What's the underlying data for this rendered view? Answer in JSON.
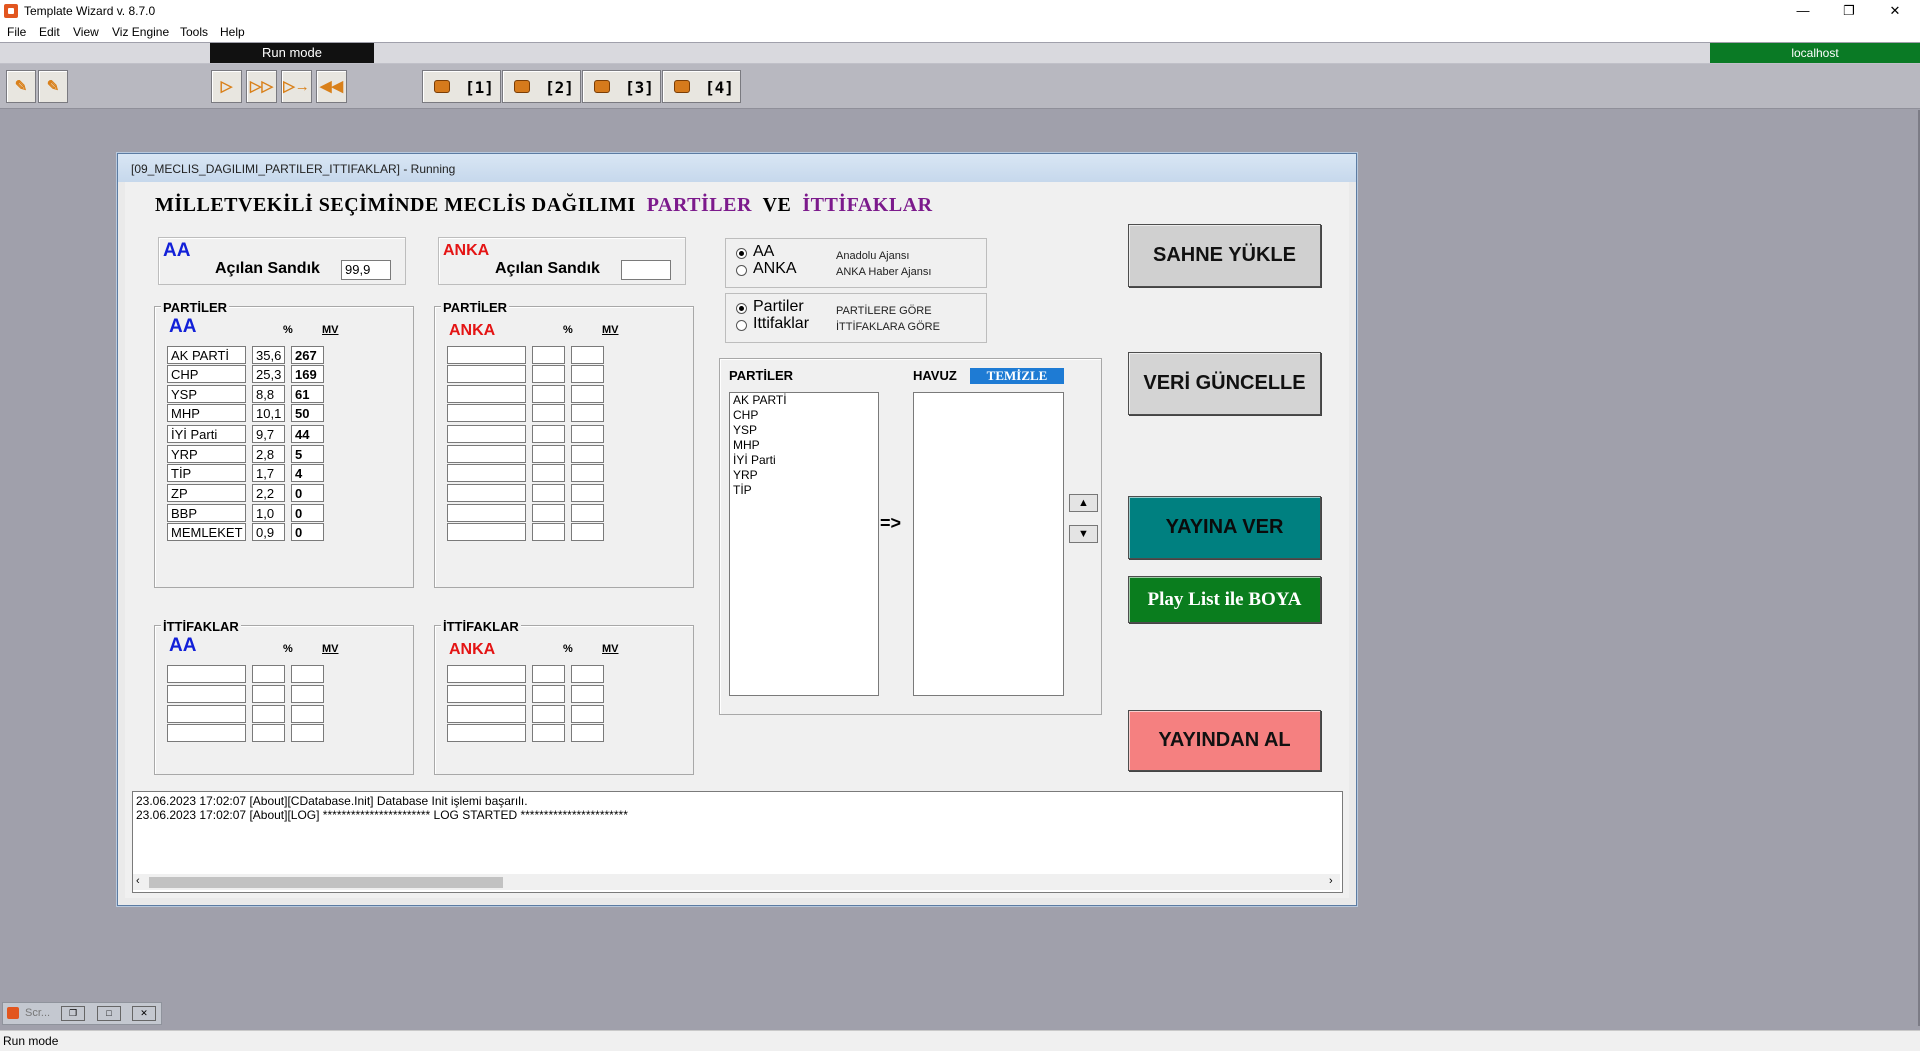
{
  "app": {
    "title": "Template Wizard v. 8.7.0"
  },
  "menu": [
    "File",
    "Edit",
    "View",
    "Viz Engine",
    "Tools",
    "Help"
  ],
  "statusstrip": {
    "mode": "Run mode",
    "host": "localhost"
  },
  "toolbar": {
    "cameras": [
      "[1]",
      "[2]",
      "[3]",
      "[4]"
    ]
  },
  "window": {
    "caption": "[09_MECLIS_DAGILIMI_PARTILER_ITTIFAKLAR] - Running",
    "heading_main": "MİLLETVEKİLİ SEÇİMİNDE MECLİS DAĞILIMI",
    "heading_p1": "PARTİLER",
    "heading_ve": "VE",
    "heading_p2": "İTTİFAKLAR"
  },
  "aa": {
    "label": "AA",
    "acilan_label": "Açılan Sandık",
    "acilan_value": "99,9",
    "partiler_title": "PARTİLER",
    "ittifak_title": "İTTİFAKLAR",
    "pct_head": "%",
    "mv_head": "MV",
    "rows": [
      {
        "name": "AK PARTİ",
        "pct": "35,6",
        "mv": "267"
      },
      {
        "name": "CHP",
        "pct": "25,3",
        "mv": "169"
      },
      {
        "name": "YSP",
        "pct": "8,8",
        "mv": "61"
      },
      {
        "name": "MHP",
        "pct": "10,1",
        "mv": "50"
      },
      {
        "name": "İYİ Parti",
        "pct": "9,7",
        "mv": "44"
      },
      {
        "name": "YRP",
        "pct": "2,8",
        "mv": "5"
      },
      {
        "name": "TİP",
        "pct": "1,7",
        "mv": "4"
      },
      {
        "name": "ZP",
        "pct": "2,2",
        "mv": "0"
      },
      {
        "name": "BBP",
        "pct": "1,0",
        "mv": "0"
      },
      {
        "name": "MEMLEKET",
        "pct": "0,9",
        "mv": "0"
      }
    ]
  },
  "anka": {
    "label": "ANKA",
    "acilan_label": "Açılan Sandık",
    "acilan_value": "",
    "partiler_title": "PARTİLER",
    "ittifak_title": "İTTİFAKLAR",
    "pct_head": "%",
    "mv_head": "MV"
  },
  "source_radio": [
    {
      "label": "AA",
      "desc": "Anadolu Ajansı",
      "checked": true
    },
    {
      "label": "ANKA",
      "desc": "ANKA Haber Ajansı",
      "checked": false
    }
  ],
  "mode_radio": [
    {
      "label": "Partiler",
      "desc": "PARTİLERE GÖRE",
      "checked": true
    },
    {
      "label": "Ittifaklar",
      "desc": "İTTİFAKLARA GÖRE",
      "checked": false
    }
  ],
  "pool": {
    "partiler_label": "PARTİLER",
    "havuz_label": "HAVUZ",
    "temizle": "TEMİZLE",
    "arrow": "=>",
    "items": [
      "AK PARTİ",
      "CHP",
      "YSP",
      "MHP",
      "İYİ Parti",
      "YRP",
      "TİP"
    ]
  },
  "buttons": {
    "sahne": "SAHNE YÜKLE",
    "guncelle": "VERİ GÜNCELLE",
    "yayina": "YAYINA VER",
    "playlist": "Play List ile BOYA",
    "yayindan": "YAYINDAN AL"
  },
  "log": [
    "23.06.2023 17:02:07 [About][CDatabase.Init] Database Init işlemi başarılı.",
    "23.06.2023 17:02:07 [About][LOG] *********************** LOG STARTED ***********************"
  ],
  "minimized": {
    "label": "Scr..."
  },
  "statusbar": {
    "text": "Run mode"
  },
  "colors": {
    "purple": "#7c1a8c",
    "aa_blue": "#1220d8",
    "anka_red": "#e41414",
    "host_green": "#0a7a25",
    "btn_teal": "#008080",
    "btn_green": "#0a7d1e",
    "btn_pink": "#f58080"
  }
}
